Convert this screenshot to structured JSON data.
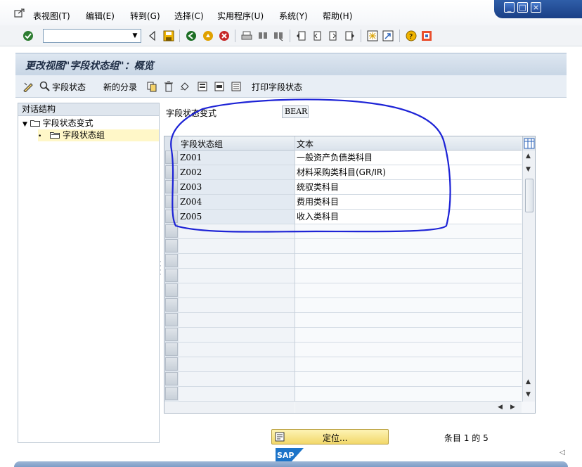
{
  "menu": {
    "items": [
      "表视图(T)",
      "编辑(E)",
      "转到(G)",
      "选择(C)",
      "实用程序(U)",
      "系统(Y)",
      "帮助(H)"
    ]
  },
  "window_controls": [
    "_",
    "□",
    "×"
  ],
  "toolbar": {
    "command_field_value": "",
    "icons": [
      "enter-icon",
      "save-icon",
      "back-icon",
      "exit-icon",
      "cancel-icon",
      "print-icon",
      "find-icon",
      "find-next-icon",
      "first-page-icon",
      "previous-page-icon",
      "next-page-icon",
      "last-page-icon",
      "new-session-icon",
      "shortcut-icon",
      "help-icon",
      "customize-layout-icon"
    ]
  },
  "title": "更改视图\"字段状态组\"：概览",
  "app_toolbar": {
    "field_status_label": "字段状态",
    "new_entries_label": "新的分录",
    "print_field_status_label": "打印字段状态"
  },
  "tree": {
    "header": "对话结构",
    "nodes": [
      {
        "label": "字段状态变式",
        "expanded": true
      },
      {
        "label": "字段状态组",
        "selected": true
      }
    ]
  },
  "variant": {
    "label": "字段状态变式",
    "value": "BEAR"
  },
  "table": {
    "columns": [
      "字段状态组",
      "文本"
    ],
    "rows": [
      {
        "group": "Z001",
        "text": "一般资产负债类科目"
      },
      {
        "group": "Z002",
        "text": "材料采购类科目(GR/IR)"
      },
      {
        "group": "Z003",
        "text": "统驭类科目"
      },
      {
        "group": "Z004",
        "text": "费用类科目"
      },
      {
        "group": "Z005",
        "text": "收入类科目"
      }
    ],
    "empty_rows": 12
  },
  "footer": {
    "position_button": "定位...",
    "entry_count": "条目 1 的 5"
  },
  "colors": {
    "annotation": "#1d23d6",
    "title_bar": "#c8d6e5",
    "position_button": "#f2d86a"
  },
  "logo_text": "SAP"
}
